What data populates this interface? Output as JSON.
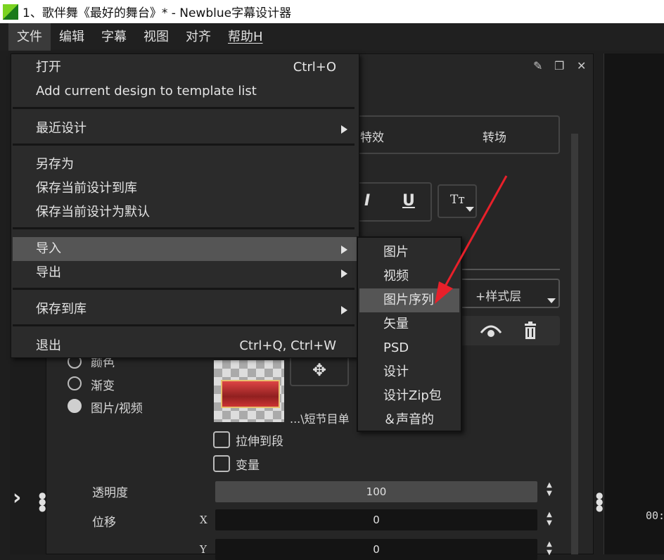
{
  "titlebar": {
    "title": "1、歌伴舞《最好的舞台》* - Newblue字幕设计器"
  },
  "menubar": {
    "items": [
      "文件",
      "编辑",
      "字幕",
      "视图",
      "对齐",
      "帮助H"
    ]
  },
  "panel": {
    "tabs": [
      "特效",
      "转场"
    ],
    "format_buttons": [
      "I",
      "U",
      "Tт"
    ],
    "style_layer_label": "+样式层",
    "fill_options": [
      "颜色",
      "渐变",
      "图片/视频"
    ],
    "file_path": "...\\短节目单",
    "checkboxes": [
      "拉伸到段",
      "变量"
    ],
    "opacity_label": "透明度",
    "opacity_value": "100",
    "offset_label": "位移",
    "x_label": "X",
    "x_value": "0",
    "y_label": "Y",
    "y_value": "0",
    "timecode": "00:"
  },
  "file_menu": {
    "items": [
      {
        "label": "打开",
        "shortcut": "Ctrl+O"
      },
      {
        "label": "Add current design to template list",
        "shortcut": ""
      },
      {
        "label": "最近设计",
        "submenu": true
      },
      {
        "label": "另存为"
      },
      {
        "label": "保存当前设计到库"
      },
      {
        "label": "保存当前设计为默认"
      },
      {
        "label": "导入",
        "submenu": true,
        "highlighted": true
      },
      {
        "label": "导出",
        "submenu": true
      },
      {
        "label": "保存到库",
        "submenu": true
      },
      {
        "label": "退出",
        "shortcut": "Ctrl+Q, Ctrl+W"
      }
    ]
  },
  "import_submenu": {
    "items": [
      "图片",
      "视频",
      "图片序列",
      "矢量",
      "PSD",
      "设计",
      "设计Zip包",
      "＆声音的"
    ],
    "highlighted_index": 2
  },
  "colors": {
    "annotation_arrow": "#e8202a",
    "highlight": "#555555"
  }
}
